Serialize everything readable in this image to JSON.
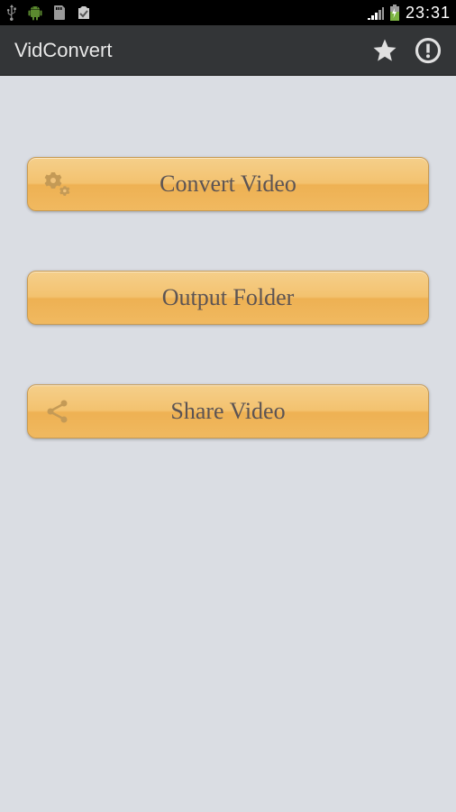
{
  "status_bar": {
    "time": "23:31"
  },
  "app_bar": {
    "title": "VidConvert"
  },
  "buttons": {
    "convert": "Convert Video",
    "output_folder": "Output Folder",
    "share": "Share Video"
  }
}
